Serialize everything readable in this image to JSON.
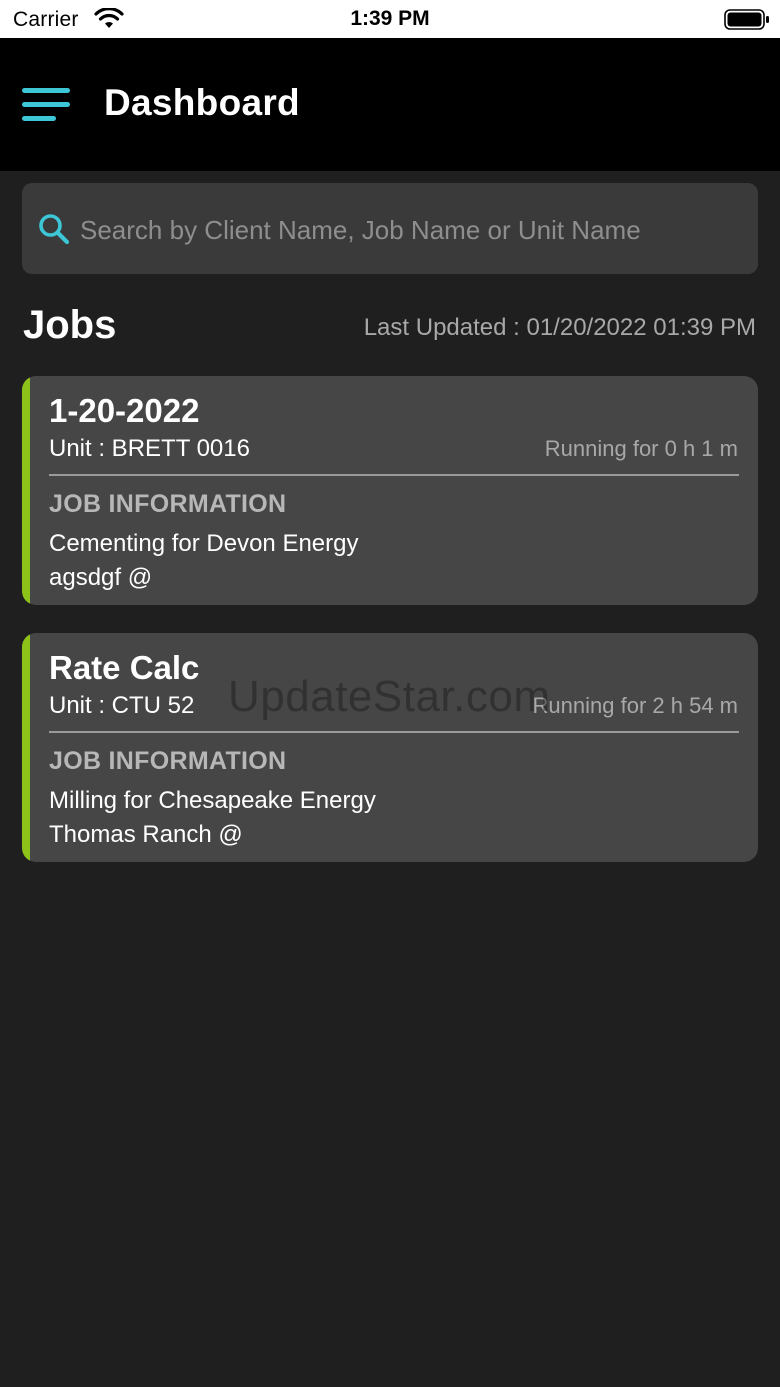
{
  "status_bar": {
    "carrier": "Carrier",
    "time": "1:39 PM",
    "wifi_icon": "wifi-icon",
    "battery_icon": "battery-icon"
  },
  "nav": {
    "title": "Dashboard",
    "menu_icon": "hamburger-menu-icon",
    "accent_color": "#3cc6d6"
  },
  "search": {
    "placeholder": "Search by Client Name, Job Name or Unit Name",
    "value": "",
    "icon": "search-icon"
  },
  "jobs_section": {
    "heading": "Jobs",
    "last_updated": "Last Updated : 01/20/2022 01:39 PM"
  },
  "jobs": [
    {
      "title": "1-20-2022",
      "unit": "Unit : BRETT 0016",
      "running": "Running for 0 h 1 m",
      "info_heading": "JOB INFORMATION",
      "info_line1": "Cementing for Devon Energy",
      "info_line2": "agsdgf @",
      "status_color": "#8dc219"
    },
    {
      "title": "Rate Calc",
      "unit": "Unit : CTU 52",
      "running": "Running for 2 h 54 m",
      "info_heading": "JOB INFORMATION",
      "info_line1": "Milling for Chesapeake Energy",
      "info_line2": "Thomas Ranch @",
      "status_color": "#8dc219"
    }
  ],
  "watermark": "UpdateStar.com",
  "colors": {
    "background": "#1f1f1f",
    "card": "#464646",
    "nav": "#000000",
    "accent": "#3cc6d6",
    "status_green": "#8dc219"
  }
}
